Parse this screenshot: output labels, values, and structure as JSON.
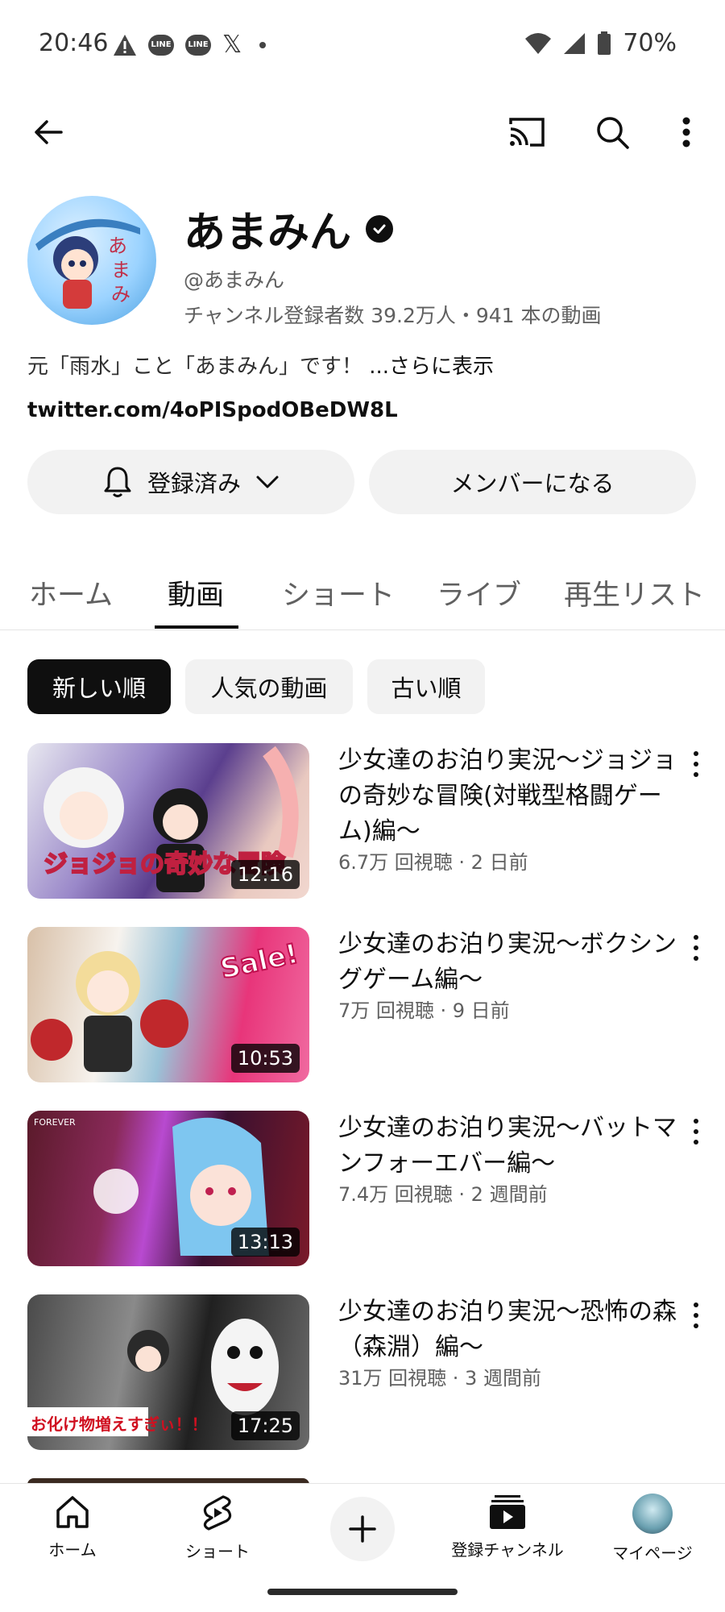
{
  "status_bar": {
    "time": "20:46",
    "line_label": "LINE",
    "x_label": "𝕏",
    "battery": "70%"
  },
  "channel": {
    "name": "あまみん",
    "handle": "@あまみん",
    "stats": "チャンネル登録者数 39.2万人・941 本の動画",
    "description": "元「雨水」こと「あまみん」です！ ",
    "description_more": "...さらに表示",
    "link": "twitter.com/4oPISpodOBeDW8L",
    "subscribed_label": "登録済み",
    "member_label": "メンバーになる"
  },
  "tabs": [
    {
      "label": "ホーム"
    },
    {
      "label": "動画"
    },
    {
      "label": "ショート"
    },
    {
      "label": "ライブ"
    },
    {
      "label": "再生リスト"
    }
  ],
  "chips": [
    {
      "label": "新しい順"
    },
    {
      "label": "人気の動画"
    },
    {
      "label": "古い順"
    }
  ],
  "videos": [
    {
      "title": "少女達のお泊り実況〜ジョジョの奇妙な冒険(対戦型格闘ゲーム)編〜",
      "meta": "6.7万 回視聴 · 2 日前",
      "duration": "12:16",
      "thumb_caption": "ジョジョの奇妙な冒険"
    },
    {
      "title": "少女達のお泊り実況〜ボクシングゲーム編〜",
      "meta": "7万 回視聴 · 9 日前",
      "duration": "10:53",
      "thumb_caption": "Sale!"
    },
    {
      "title": "少女達のお泊り実況〜バットマンフォーエバー編〜",
      "meta": "7.4万 回視聴 · 2 週間前",
      "duration": "13:13",
      "thumb_caption": "FOREVER"
    },
    {
      "title": "少女達のお泊り実況〜恐怖の森（森淵）編〜",
      "meta": "31万 回視聴 · 3 週間前",
      "duration": "17:25",
      "thumb_caption": "お化け物増えすぎぃ！！"
    }
  ],
  "bottom_nav": {
    "home": "ホーム",
    "shorts": "ショート",
    "subscriptions": "登録チャンネル",
    "mypage": "マイページ"
  },
  "colors": {
    "text_primary": "#0f0f0f",
    "text_secondary": "#606060",
    "chip_bg": "#f2f2f2",
    "chip_active_bg": "#0f0f0f"
  },
  "icons": [
    "back-arrow-icon",
    "cast-icon",
    "search-icon",
    "more-vert-icon",
    "bell-icon",
    "chevron-down-icon",
    "verified-icon",
    "home-icon",
    "shorts-icon",
    "plus-icon",
    "subscriptions-icon"
  ]
}
